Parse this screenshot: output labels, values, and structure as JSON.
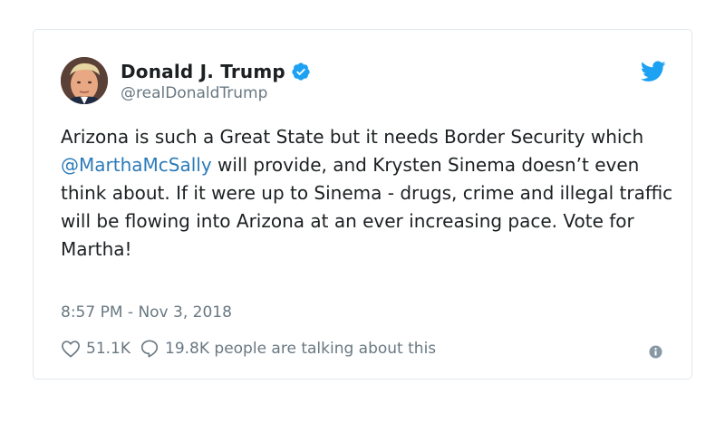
{
  "author": {
    "display_name": "Donald J. Trump",
    "handle": "@realDonaldTrump",
    "verified": true
  },
  "tweet": {
    "text_before": "Arizona is such a Great State but it needs Border Security which ",
    "mention": "@MarthaMcSally",
    "text_after": " will provide, and Krysten Sinema doesn’t even think about. If it were up to Sinema - drugs, crime and illegal traffic will be flowing into Arizona at an ever increasing pace. Vote for Martha!",
    "timestamp": "8:57 PM - Nov 3, 2018"
  },
  "actions": {
    "like_count": "51.1K",
    "conversation_text": "19.8K people are talking about this"
  },
  "icons": {
    "brand": "twitter-bird-icon",
    "verified": "verified-badge-icon",
    "like": "heart-icon",
    "reply": "speech-bubble-icon",
    "info": "info-icon"
  },
  "colors": {
    "brand_blue": "#1da1f2",
    "link_blue": "#2b7bb9",
    "muted_gray": "#697882",
    "text": "#1c2022",
    "border": "#e1e8ed"
  }
}
